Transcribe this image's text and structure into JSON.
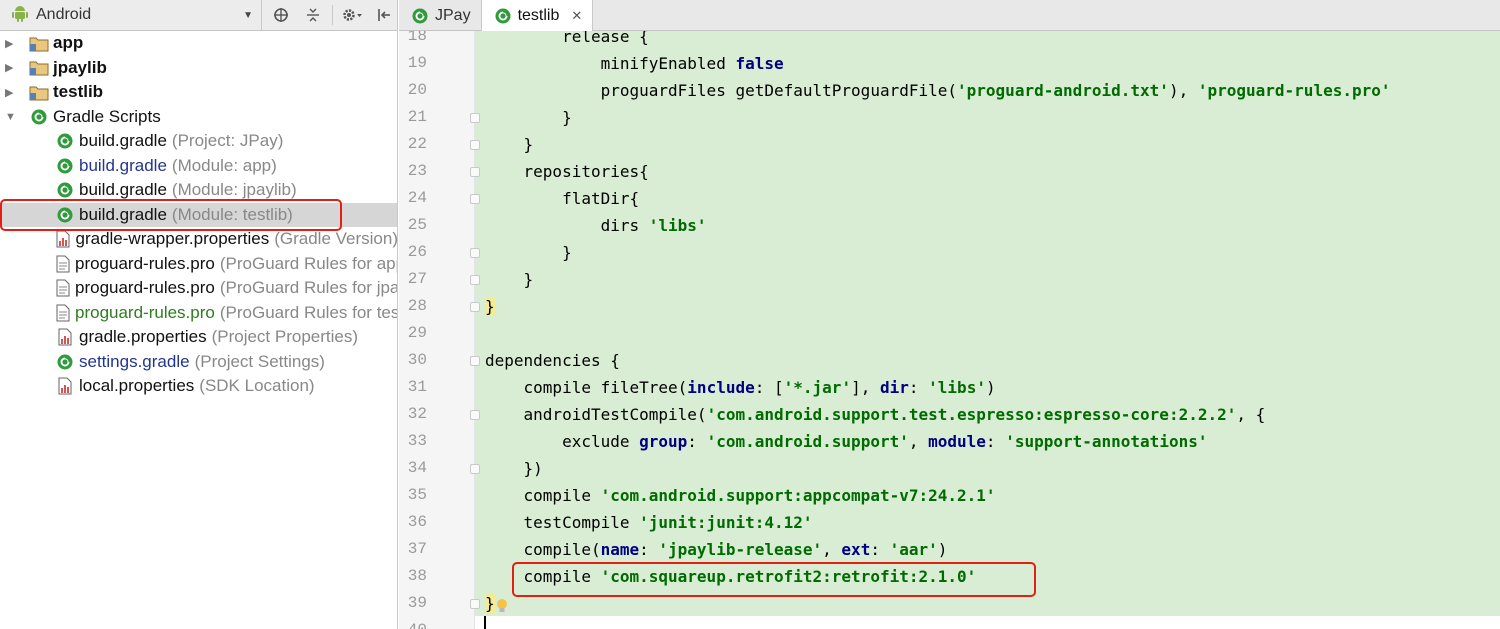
{
  "project_panel": {
    "view_mode": "Android",
    "tree": [
      {
        "name": "app",
        "desc": "",
        "icon": "module-folder-icon",
        "level": 1,
        "style": "bold"
      },
      {
        "name": "jpaylib",
        "desc": "",
        "icon": "module-folder-icon",
        "level": 1,
        "style": "bold"
      },
      {
        "name": "testlib",
        "desc": "",
        "icon": "module-folder-icon",
        "level": 1,
        "style": "bold"
      },
      {
        "name": "Gradle Scripts",
        "desc": "",
        "icon": "gradle-icon",
        "level": 1,
        "style": "dark"
      },
      {
        "name": "build.gradle",
        "desc": "(Project: JPay)",
        "icon": "gradle-icon",
        "level": 2,
        "style": "dark"
      },
      {
        "name": "build.gradle",
        "desc": "(Module: app)",
        "icon": "gradle-icon",
        "level": 2,
        "style": "blue"
      },
      {
        "name": "build.gradle",
        "desc": "(Module: jpaylib)",
        "icon": "gradle-icon",
        "level": 2,
        "style": "dark"
      },
      {
        "name": "build.gradle",
        "desc": "(Module: testlib)",
        "icon": "gradle-icon",
        "level": 2,
        "style": "dark",
        "selected": true
      },
      {
        "name": "gradle-wrapper.properties",
        "desc": "(Gradle Version)",
        "icon": "properties-icon",
        "level": 2,
        "style": "dark"
      },
      {
        "name": "proguard-rules.pro",
        "desc": "(ProGuard Rules for app)",
        "icon": "file-icon",
        "level": 2,
        "style": "dark"
      },
      {
        "name": "proguard-rules.pro",
        "desc": "(ProGuard Rules for jpaylib)",
        "icon": "file-icon",
        "level": 2,
        "style": "dark"
      },
      {
        "name": "proguard-rules.pro",
        "desc": "(ProGuard Rules for testlib)",
        "icon": "file-icon",
        "level": 2,
        "style": "green"
      },
      {
        "name": "gradle.properties",
        "desc": "(Project Properties)",
        "icon": "properties-icon",
        "level": 2,
        "style": "dark"
      },
      {
        "name": "settings.gradle",
        "desc": "(Project Settings)",
        "icon": "gradle-icon",
        "level": 2,
        "style": "blue"
      },
      {
        "name": "local.properties",
        "desc": "(SDK Location)",
        "icon": "properties-icon",
        "level": 2,
        "style": "dark"
      }
    ]
  },
  "editor": {
    "tabs": [
      {
        "label": "JPay",
        "active": false
      },
      {
        "label": "testlib",
        "active": true
      }
    ],
    "lines": [
      {
        "n": "18",
        "segs": [
          [
            "        release {",
            ""
          ]
        ]
      },
      {
        "n": "19",
        "segs": [
          [
            "            minifyEnabled ",
            ""
          ],
          [
            "false",
            "kw"
          ]
        ]
      },
      {
        "n": "20",
        "segs": [
          [
            "            proguardFiles getDefaultProguardFile(",
            ""
          ],
          [
            "'proguard-android.txt'",
            "str"
          ],
          [
            "), ",
            ""
          ],
          [
            "'proguard-rules.pro'",
            "str"
          ]
        ]
      },
      {
        "n": "21",
        "segs": [
          [
            "        }",
            ""
          ]
        ],
        "fold": true
      },
      {
        "n": "22",
        "segs": [
          [
            "    }",
            ""
          ]
        ],
        "fold": true
      },
      {
        "n": "23",
        "segs": [
          [
            "    repositories{",
            ""
          ]
        ],
        "fold": true
      },
      {
        "n": "24",
        "segs": [
          [
            "        flatDir{",
            ""
          ]
        ],
        "fold": true
      },
      {
        "n": "25",
        "segs": [
          [
            "            dirs ",
            ""
          ],
          [
            "'libs'",
            "str"
          ]
        ]
      },
      {
        "n": "26",
        "segs": [
          [
            "        }",
            ""
          ]
        ],
        "fold": true
      },
      {
        "n": "27",
        "segs": [
          [
            "    }",
            ""
          ]
        ],
        "fold": true
      },
      {
        "n": "28",
        "segs": [
          [
            "}",
            "brace-hl"
          ]
        ],
        "fold": true
      },
      {
        "n": "29",
        "segs": [
          [
            "",
            ""
          ]
        ]
      },
      {
        "n": "30",
        "segs": [
          [
            "dependencies {",
            ""
          ]
        ],
        "fold": true
      },
      {
        "n": "31",
        "segs": [
          [
            "    compile fileTree(",
            ""
          ],
          [
            "include",
            "named"
          ],
          [
            ": [",
            ""
          ],
          [
            "'*.jar'",
            "str"
          ],
          [
            "], ",
            ""
          ],
          [
            "dir",
            "named"
          ],
          [
            ": ",
            ""
          ],
          [
            "'libs'",
            "str"
          ],
          [
            ")",
            ""
          ]
        ]
      },
      {
        "n": "32",
        "segs": [
          [
            "    androidTestCompile(",
            ""
          ],
          [
            "'com.android.support.test.espresso:espresso-core:2.2.2'",
            "str"
          ],
          [
            ", {",
            ""
          ]
        ],
        "fold": true
      },
      {
        "n": "33",
        "segs": [
          [
            "        exclude ",
            ""
          ],
          [
            "group",
            "named"
          ],
          [
            ": ",
            ""
          ],
          [
            "'com.android.support'",
            "str"
          ],
          [
            ", ",
            ""
          ],
          [
            "module",
            "named"
          ],
          [
            ": ",
            ""
          ],
          [
            "'support-annotations'",
            "str"
          ]
        ]
      },
      {
        "n": "34",
        "segs": [
          [
            "    })",
            ""
          ]
        ],
        "fold": true
      },
      {
        "n": "35",
        "segs": [
          [
            "    compile ",
            ""
          ],
          [
            "'com.android.support:appcompat-v7:24.2.1'",
            "str"
          ]
        ]
      },
      {
        "n": "36",
        "segs": [
          [
            "    testCompile ",
            ""
          ],
          [
            "'junit:junit:4.12'",
            "str"
          ]
        ]
      },
      {
        "n": "37",
        "segs": [
          [
            "    compile(",
            ""
          ],
          [
            "name",
            "named"
          ],
          [
            ": ",
            ""
          ],
          [
            "'jpaylib-release'",
            "str"
          ],
          [
            ", ",
            ""
          ],
          [
            "ext",
            "named"
          ],
          [
            ": ",
            ""
          ],
          [
            "'aar'",
            "str"
          ],
          [
            ")",
            ""
          ]
        ]
      },
      {
        "n": "38",
        "segs": [
          [
            "    compile ",
            ""
          ],
          [
            "'com.squareup.retrofit2:retrofit:2.1.0'",
            "str"
          ]
        ]
      },
      {
        "n": "39",
        "segs": [
          [
            "}",
            "brace-hl"
          ]
        ],
        "fold": true
      },
      {
        "n": "40",
        "segs": [
          [
            "",
            ""
          ]
        ]
      }
    ]
  }
}
